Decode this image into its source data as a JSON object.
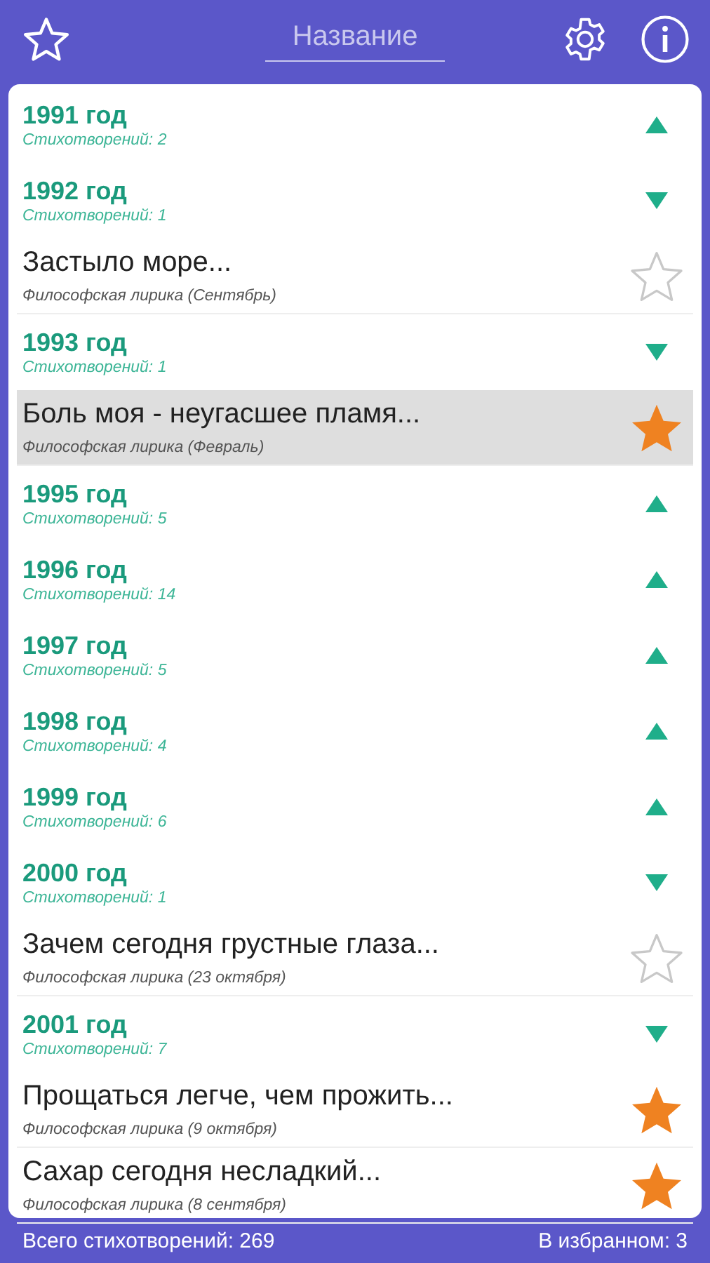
{
  "header": {
    "search": {
      "placeholder": "Название"
    }
  },
  "items": [
    {
      "kind": "year",
      "title": "1991 год",
      "subtitle": "Стихотворений: 2",
      "expanded": false
    },
    {
      "kind": "year",
      "title": "1992 год",
      "subtitle": "Стихотворений: 1",
      "expanded": true
    },
    {
      "kind": "poem",
      "title": "Застыло море...",
      "subtitle": "Философская лирика (Сентябрь)",
      "favorite": false,
      "selected": false
    },
    {
      "kind": "year",
      "title": "1993 год",
      "subtitle": "Стихотворений: 1",
      "expanded": true
    },
    {
      "kind": "poem",
      "title": "Боль моя - неугасшее пламя...",
      "subtitle": "Философская лирика (Февраль)",
      "favorite": true,
      "selected": true
    },
    {
      "kind": "year",
      "title": "1995 год",
      "subtitle": "Стихотворений: 5",
      "expanded": false
    },
    {
      "kind": "year",
      "title": "1996 год",
      "subtitle": "Стихотворений: 14",
      "expanded": false
    },
    {
      "kind": "year",
      "title": "1997 год",
      "subtitle": "Стихотворений: 5",
      "expanded": false
    },
    {
      "kind": "year",
      "title": "1998 год",
      "subtitle": "Стихотворений: 4",
      "expanded": false
    },
    {
      "kind": "year",
      "title": "1999 год",
      "subtitle": "Стихотворений: 6",
      "expanded": false
    },
    {
      "kind": "year",
      "title": "2000 год",
      "subtitle": "Стихотворений: 1",
      "expanded": true
    },
    {
      "kind": "poem",
      "title": "Зачем сегодня грустные глаза...",
      "subtitle": "Философская лирика (23 октября)",
      "favorite": false,
      "selected": false
    },
    {
      "kind": "year",
      "title": "2001 год",
      "subtitle": "Стихотворений: 7",
      "expanded": true
    },
    {
      "kind": "poem",
      "title": "Прощаться легче, чем прожить...",
      "subtitle": "Философская лирика (9 октября)",
      "favorite": true,
      "selected": false
    },
    {
      "kind": "poem",
      "title": "Сахар сегодня несладкий...",
      "subtitle": "Философская лирика (8 сентября)",
      "favorite": true,
      "selected": false
    }
  ],
  "status_bar": {
    "total": "Всего стихотворений: 269",
    "favorites": "В избранном: 3"
  }
}
